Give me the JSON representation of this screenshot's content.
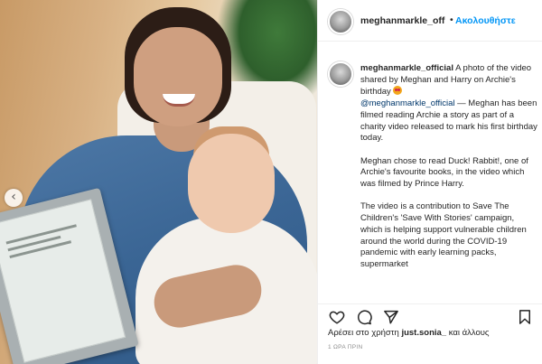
{
  "post": {
    "author": "meghanmarkle_off",
    "follow_label": "Ακολουθήστε",
    "header_separator": "•"
  },
  "caption": {
    "author": "meghanmarkle_official",
    "line1": " A photo of the video shared by Meghan and Harry on Archie's birthday ",
    "mention": "@meghanmarkle_official",
    "line1b": " — Meghan has been filmed reading Archie a story as part of a charity video released to mark his first birthday today.",
    "para2": "Meghan chose to read Duck! Rabbit!, one of Archie's favourite books, in the video which was filmed by Prince Harry.",
    "para3": "The video is a contribution to Save The Children's 'Save With Stories' campaign, which is helping support vulnerable children around the world during the COVID-19 pandemic with early learning packs, supermarket"
  },
  "likes": {
    "prefix": "Αρέσει στο χρήστη ",
    "user": "just.sonia_",
    "suffix": " και άλλους"
  },
  "timestamp": "1 ΩΡΑ ΠΡΙΝ",
  "icons": {
    "prev": "chevron-left-icon",
    "like": "heart-icon",
    "comment": "comment-icon",
    "share": "paper-plane-icon",
    "save": "bookmark-icon",
    "more": "more-options-icon"
  },
  "colors": {
    "follow": "#0095f6",
    "text": "#262626",
    "muted": "#8e8e8e"
  }
}
